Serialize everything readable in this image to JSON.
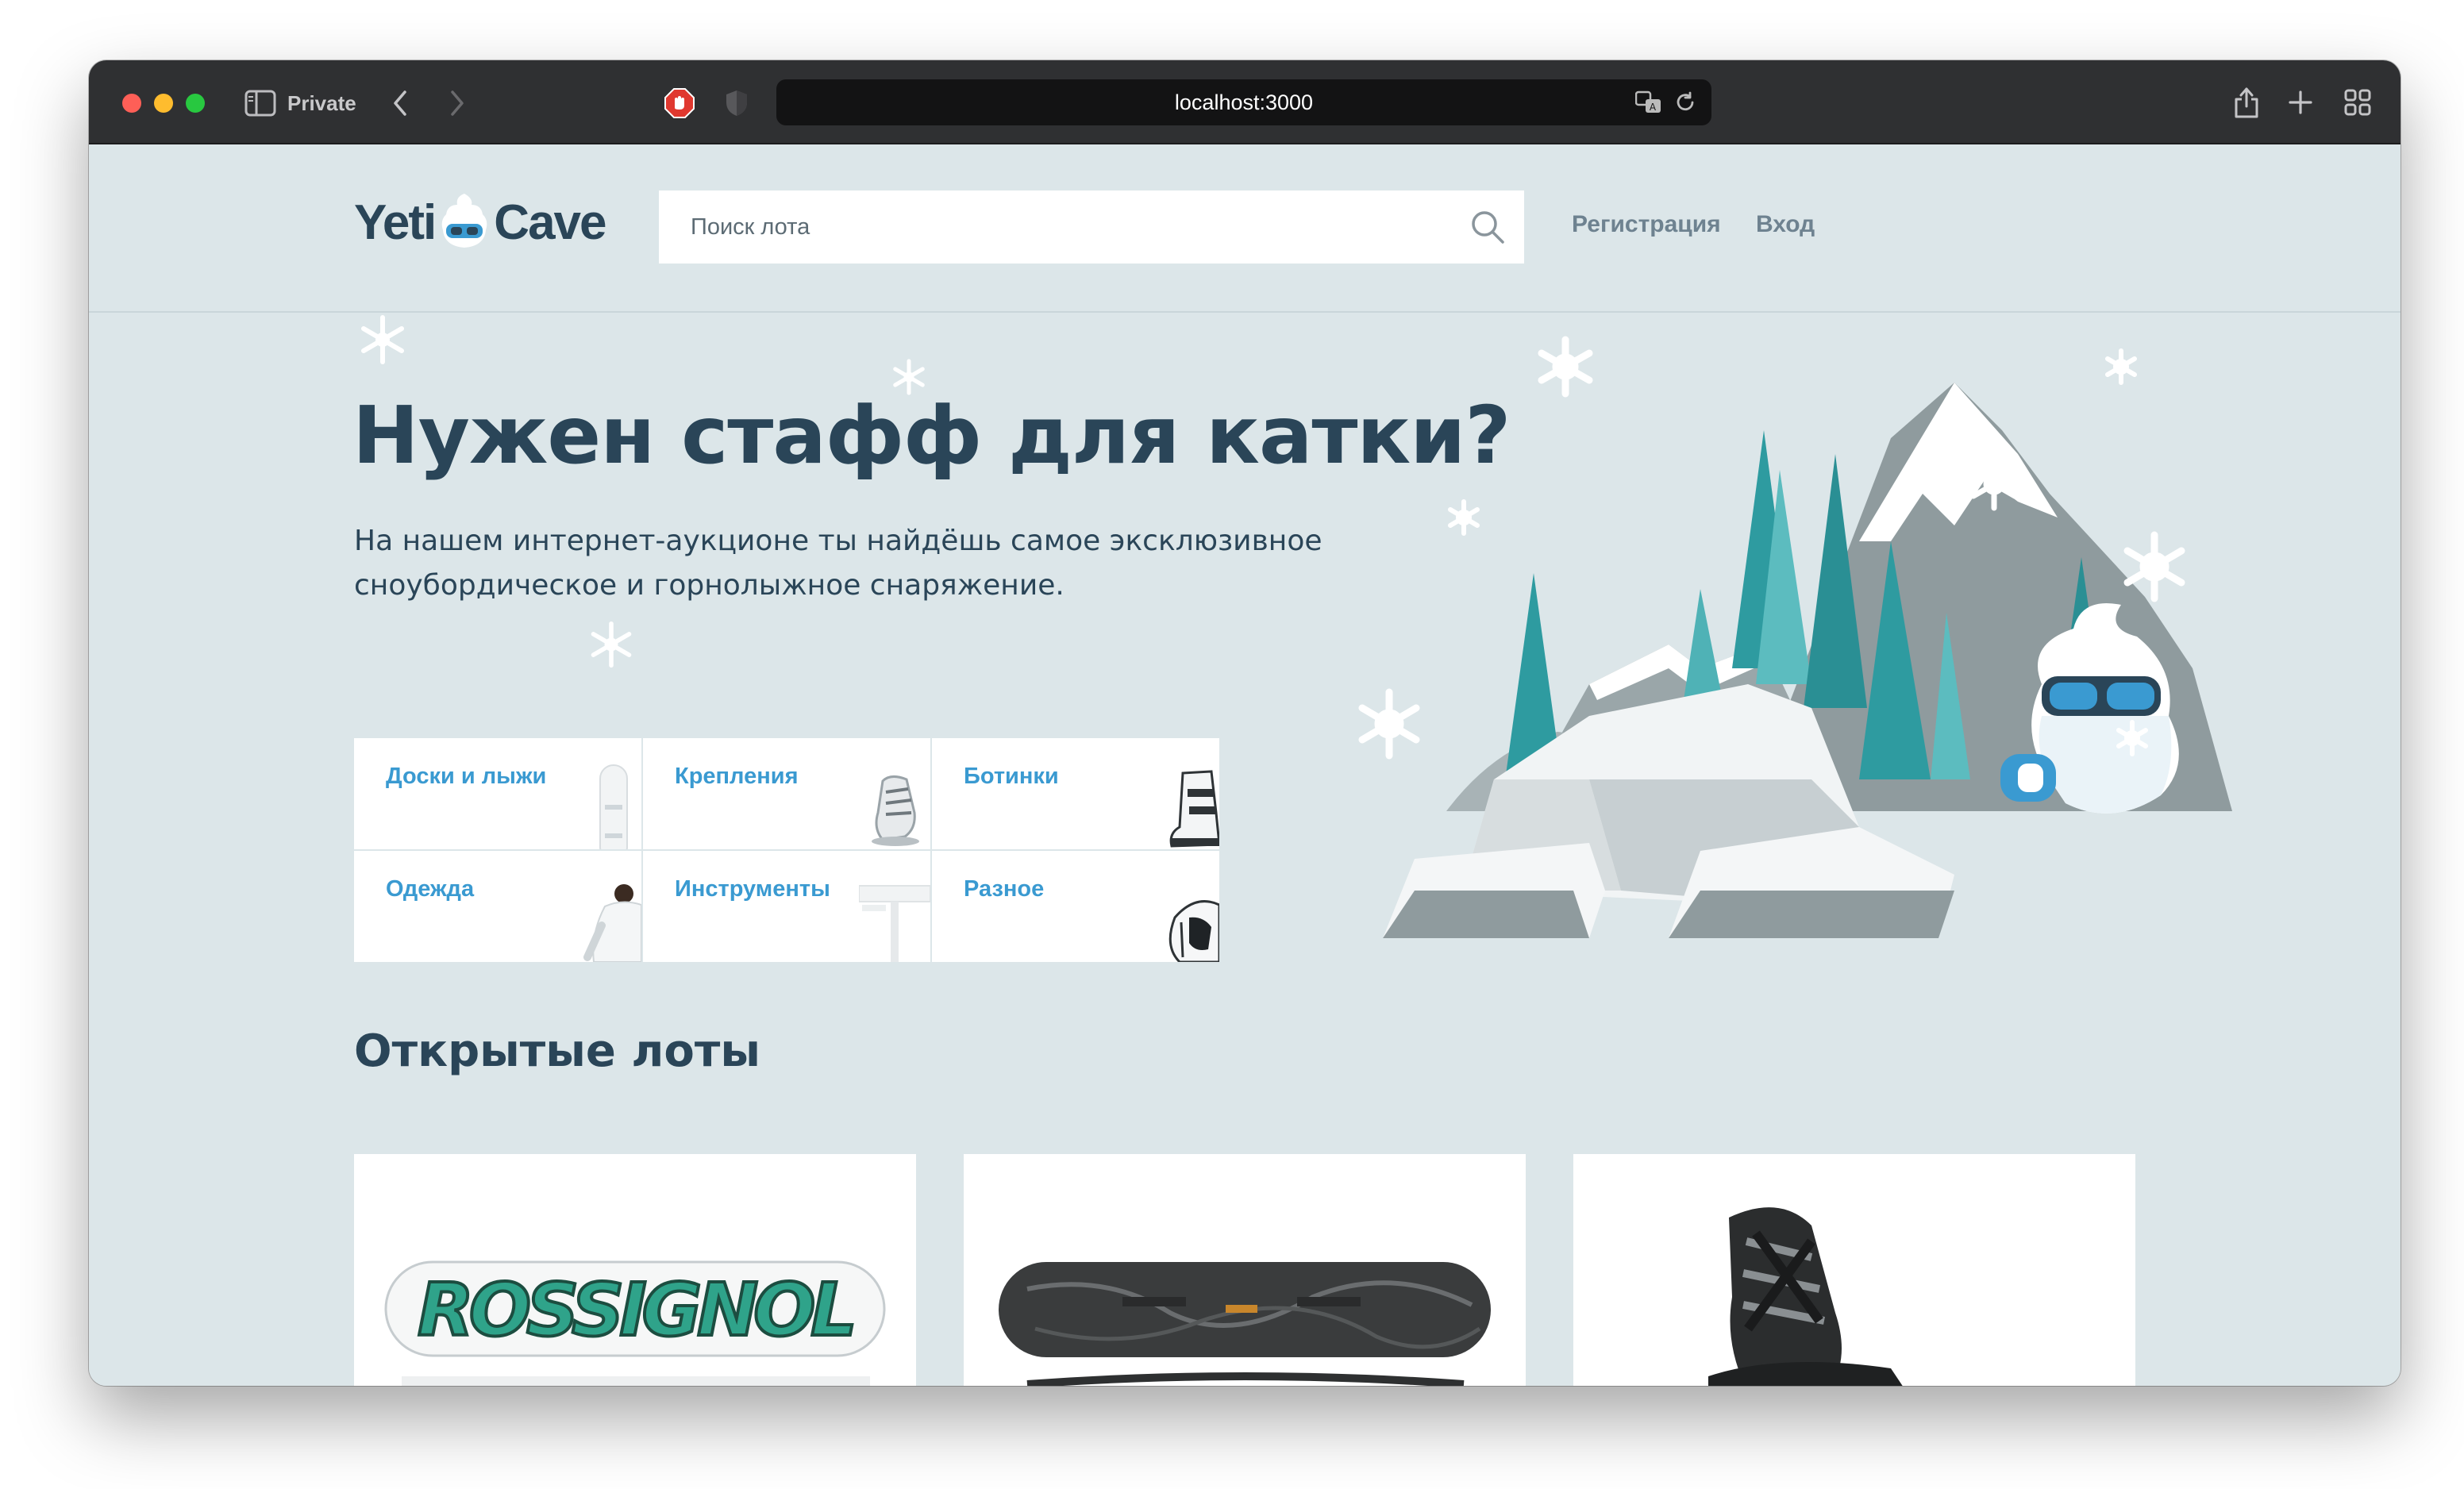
{
  "browser": {
    "private_label": "Private",
    "url": "localhost:3000"
  },
  "header": {
    "logo_left": "Yeti",
    "logo_right": "Cave",
    "search_placeholder": "Поиск лота",
    "register_link": "Регистрация",
    "login_link": "Вход"
  },
  "promo": {
    "title": "Нужен стафф для катки?",
    "text": "На нашем интернет-аукционе ты найдёшь самое эксклюзивное сноубордическое и горнолыжное снаряжение."
  },
  "categories": [
    {
      "label": "Доски и лыжи",
      "icon": "snowboard-icon"
    },
    {
      "label": "Крепления",
      "icon": "binding-icon"
    },
    {
      "label": "Ботинки",
      "icon": "boot-icon"
    },
    {
      "label": "Одежда",
      "icon": "jacket-icon"
    },
    {
      "label": "Инструменты",
      "icon": "tool-icon"
    },
    {
      "label": "Разное",
      "icon": "goggles-icon"
    }
  ],
  "lots": {
    "section_title": "Открытые лоты",
    "items": [
      {
        "image": "rossignol-snowboard-image",
        "brand_print": "ROSSIGNOL"
      },
      {
        "image": "black-snowboard-image"
      },
      {
        "image": "binding-image"
      }
    ]
  },
  "colors": {
    "page_background": "#dce6e9",
    "heading": "#2a4558",
    "link_blue": "#3a9ad1",
    "muted_link": "#6e8290",
    "toolbar": "#2f3032"
  }
}
